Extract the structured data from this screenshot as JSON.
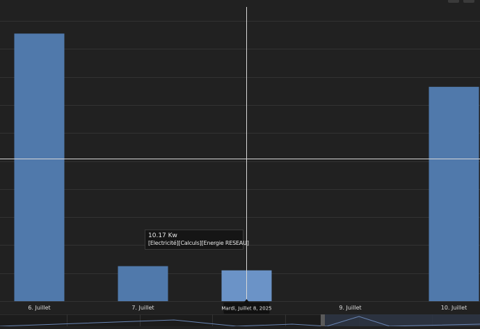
{
  "chart_data": {
    "type": "bar",
    "categories": [
      "6. Juillet",
      "7. Juillet",
      "8. Juillet",
      "9. Juillet",
      "10. Juillet"
    ],
    "values": [
      19.1,
      2.5,
      2.2,
      null,
      15.3
    ],
    "series_color": "#5079ab",
    "highlight_color": "#6b93c7",
    "highlighted_index": 2,
    "crosshair_value": 10.17,
    "grid": true,
    "ylim": [
      0,
      21
    ],
    "title": "",
    "xlabel": "",
    "ylabel": ""
  },
  "tooltip": {
    "value": "10.17 Kw",
    "series": "[Electricité][Calculs][Energie RESEAU]"
  },
  "crosshair_label": "Mardi, Juillet 8, 2025",
  "colors": {
    "background": "#212121",
    "grid": "#333333",
    "crosshair": "#d8d8d8",
    "navigator_bg": "#1c1c1c",
    "navigator_selected": "#2e3544",
    "navigator_handle": "#5a5a5a",
    "navigator_line": "#6a86b5"
  }
}
